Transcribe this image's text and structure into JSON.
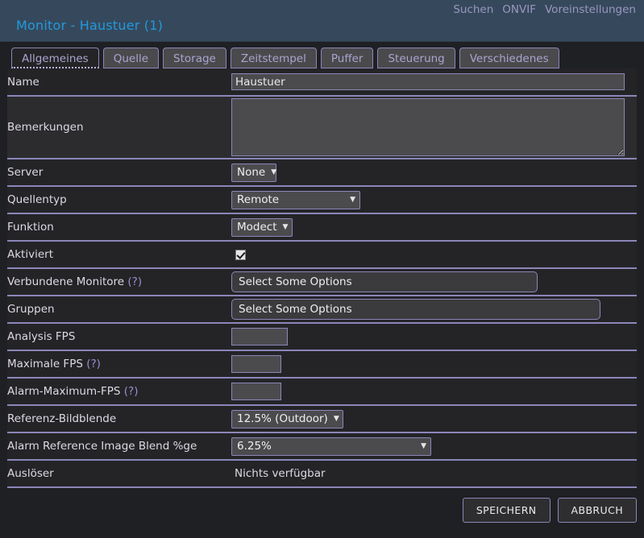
{
  "header": {
    "title": "Monitor - Haustuer (1)",
    "nav": [
      {
        "label": "Suchen"
      },
      {
        "label": "ONVIF"
      },
      {
        "label": "Voreinstellungen"
      }
    ]
  },
  "tabs": [
    {
      "label": "Allgemeines",
      "active": true
    },
    {
      "label": "Quelle",
      "active": false
    },
    {
      "label": "Storage",
      "active": false
    },
    {
      "label": "Zeitstempel",
      "active": false
    },
    {
      "label": "Puffer",
      "active": false
    },
    {
      "label": "Steuerung",
      "active": false
    },
    {
      "label": "Verschiedenes",
      "active": false
    }
  ],
  "form": {
    "name": {
      "label": "Name",
      "value": "Haustuer"
    },
    "notes": {
      "label": "Bemerkungen",
      "value": "",
      "placeholder": ""
    },
    "server": {
      "label": "Server",
      "value": "None"
    },
    "source_type": {
      "label": "Quellentyp",
      "value": "Remote"
    },
    "function": {
      "label": "Funktion",
      "value": "Modect"
    },
    "enabled": {
      "label": "Aktiviert",
      "checked": true
    },
    "linked_monitors": {
      "label": "Verbundene Monitore",
      "help": "(?)",
      "value": "Select Some Options"
    },
    "groups": {
      "label": "Gruppen",
      "value": "Select Some Options"
    },
    "analysis_fps": {
      "label": "Analysis FPS",
      "value": ""
    },
    "max_fps": {
      "label": "Maximale FPS",
      "help": "(?)",
      "value": ""
    },
    "alarm_max_fps": {
      "label": "Alarm-Maximum-FPS",
      "help": "(?)",
      "value": ""
    },
    "ref_blend": {
      "label": "Referenz-Bildblende",
      "value": "12.5% (Outdoor)"
    },
    "alarm_ref_blend": {
      "label": "Alarm Reference Image Blend %ge",
      "value": "6.25%"
    },
    "triggers": {
      "label": "Auslöser",
      "value": "Nichts verfügbar"
    }
  },
  "footer": {
    "save": "SPEICHERN",
    "cancel": "ABBRUCH"
  },
  "colors": {
    "header_bg": "#36495c",
    "title": "#2299dd",
    "accent_rule": "#8b86b8",
    "body_bg": "#1f2023",
    "row_bg": "#242427",
    "link": "#9a96c0"
  }
}
